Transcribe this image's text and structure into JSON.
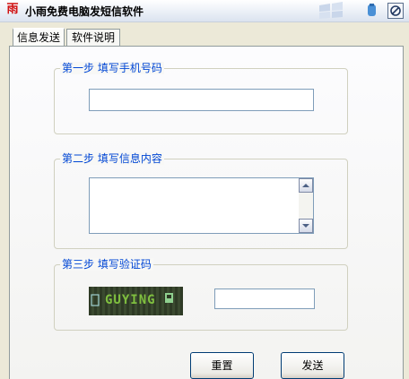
{
  "window": {
    "title": "小雨免费电脑发短信软件",
    "app_icon": "雨"
  },
  "tabs": [
    {
      "label": "信息发送"
    },
    {
      "label": "软件说明"
    }
  ],
  "step1": {
    "legend": "第一步  填写手机号码",
    "phone_value": ""
  },
  "step2": {
    "legend": "第二步  填写信息内容",
    "message_value": ""
  },
  "step3": {
    "legend": "第三步  填写验证码",
    "captcha_text": "GUYING",
    "code_value": ""
  },
  "buttons": {
    "reset": "重置",
    "send": "发送"
  },
  "colors": {
    "legend": "#0046d5",
    "border": "#7f9db9",
    "captcha_bg": "#2e3a25"
  }
}
